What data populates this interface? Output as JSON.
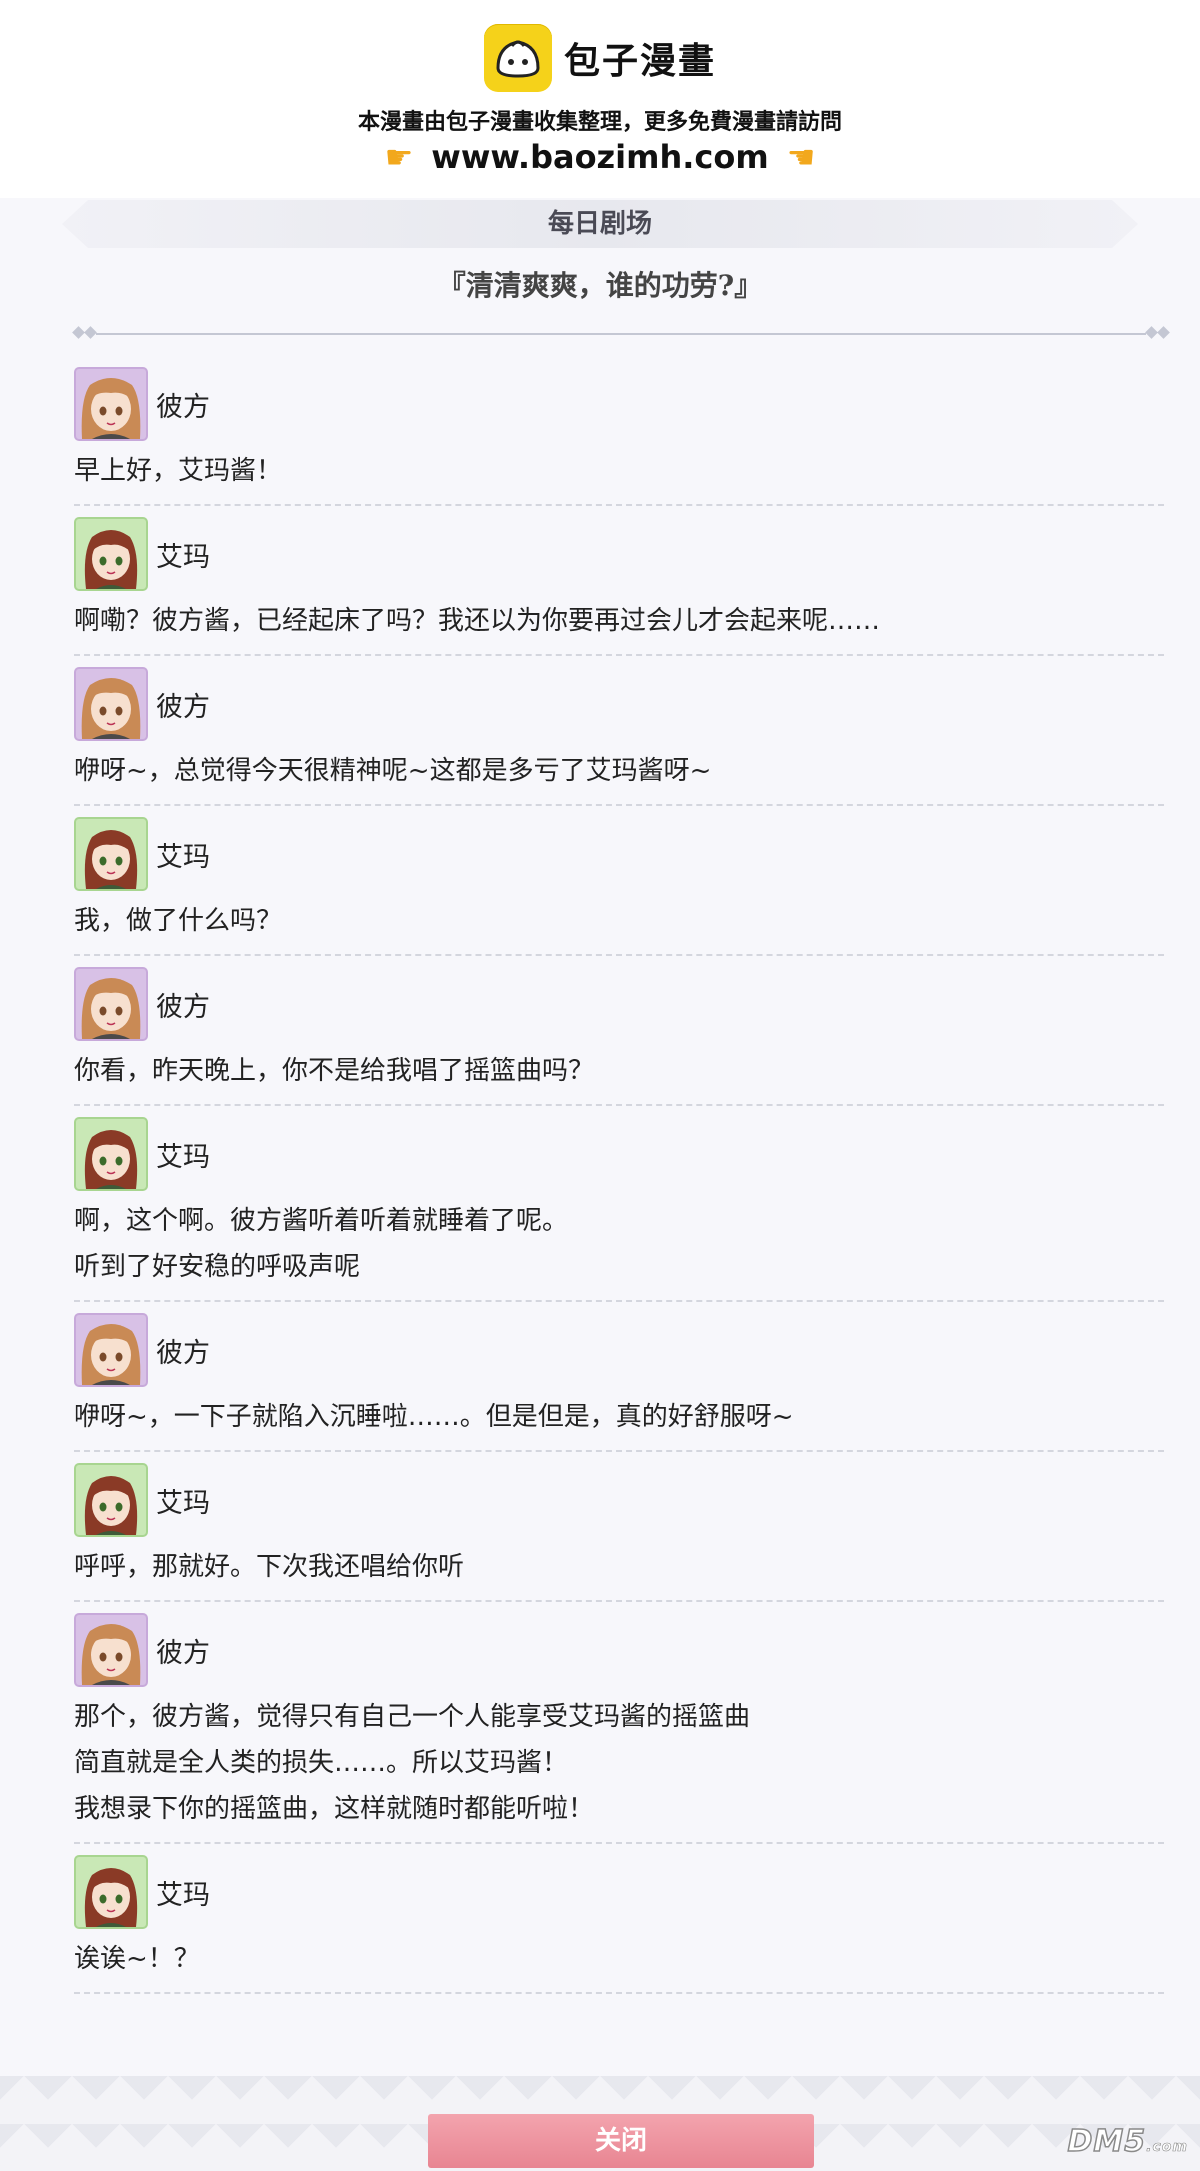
{
  "banner": {
    "brand_name": "包子漫畫",
    "note": "本漫畫由包子漫畫收集整理，更多免費漫畫請訪問",
    "url": "www.baozimh.com",
    "logo_color": "#f5d21a"
  },
  "dialog": {
    "title": "每日剧场",
    "subtitle": "『清清爽爽，谁的功劳?』",
    "entries": [
      {
        "speaker": "彼方",
        "avatar": "kanata-avatar",
        "lines": [
          "早上好，艾玛酱！"
        ]
      },
      {
        "speaker": "艾玛",
        "avatar": "ema-avatar",
        "lines": [
          "啊嘞？彼方酱，已经起床了吗？我还以为你要再过会儿才会起来呢……"
        ]
      },
      {
        "speaker": "彼方",
        "avatar": "kanata-avatar",
        "lines": [
          "咿呀~，总觉得今天很精神呢~这都是多亏了艾玛酱呀~"
        ]
      },
      {
        "speaker": "艾玛",
        "avatar": "ema-avatar",
        "lines": [
          "我，做了什么吗？"
        ]
      },
      {
        "speaker": "彼方",
        "avatar": "kanata-avatar",
        "lines": [
          "你看，昨天晚上，你不是给我唱了摇篮曲吗？"
        ]
      },
      {
        "speaker": "艾玛",
        "avatar": "ema-avatar",
        "lines": [
          "啊，这个啊。彼方酱听着听着就睡着了呢。",
          "听到了好安稳的呼吸声呢"
        ]
      },
      {
        "speaker": "彼方",
        "avatar": "kanata-avatar",
        "lines": [
          "咿呀~，一下子就陷入沉睡啦……。但是但是，真的好舒服呀~"
        ]
      },
      {
        "speaker": "艾玛",
        "avatar": "ema-avatar",
        "lines": [
          "呼呼，那就好。下次我还唱给你听"
        ]
      },
      {
        "speaker": "彼方",
        "avatar": "kanata-avatar",
        "lines": [
          "那个，彼方酱，觉得只有自己一个人能享受艾玛酱的摇篮曲",
          "简直就是全人类的损失……。所以艾玛酱！",
          "我想录下你的摇篮曲，这样就随时都能听啦！"
        ]
      },
      {
        "speaker": "艾玛",
        "avatar": "ema-avatar",
        "lines": [
          "诶诶~！？"
        ]
      }
    ],
    "close_label": "关闭"
  },
  "watermark": {
    "text": "DM5",
    "suffix": ".com"
  },
  "colors": {
    "close_button": "#ec8f9b",
    "kanata_avatar_bg": "#d8c1e6",
    "ema_avatar_bg": "#c9e8b6"
  }
}
